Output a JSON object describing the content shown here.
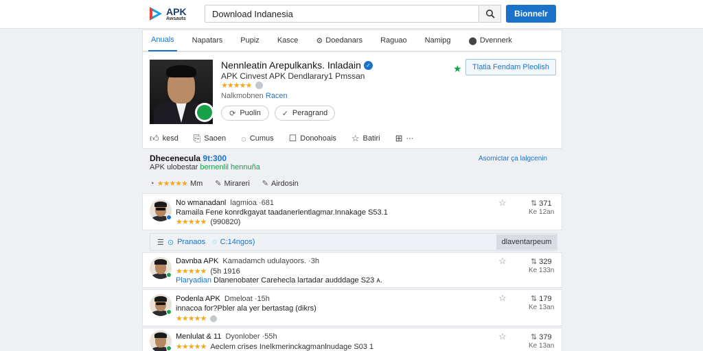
{
  "header": {
    "logo_line1": "APK",
    "logo_line2": "Awsauts",
    "search_value": "Download Indanesia",
    "primary_button": "Bionnelr"
  },
  "tabs": [
    {
      "label": "Anuals",
      "active": true,
      "icon": ""
    },
    {
      "label": "Napatars",
      "active": false,
      "icon": ""
    },
    {
      "label": "Pupiz",
      "active": false,
      "icon": ""
    },
    {
      "label": "Kasce",
      "active": false,
      "icon": ""
    },
    {
      "label": "Doedanars",
      "active": false,
      "icon": "gear-icon"
    },
    {
      "label": "Raguao",
      "active": false,
      "icon": ""
    },
    {
      "label": "Namipg",
      "active": false,
      "icon": ""
    },
    {
      "label": "Dvennerk",
      "active": false,
      "icon": "pin-icon"
    }
  ],
  "profile": {
    "title": "Nennleatin Arepulkanks. Inladain",
    "subtitle": "APK Cinvest APK Dendlarary1 Pmssan",
    "category_prefix": "Nalkmobnen",
    "category_link": "Racen",
    "pill_left": "Puolin",
    "pill_right": "Peragrand",
    "follow_button": "Tlatia Fendam Pleolish",
    "rating_fraction": 0.8
  },
  "actions": [
    {
      "label": "kesd",
      "icon": "thumbs-up-icon"
    },
    {
      "label": "Saoen",
      "icon": "save-icon"
    },
    {
      "label": "Cumus",
      "icon": "comment-icon"
    },
    {
      "label": "Donohoais",
      "icon": "download-icon"
    },
    {
      "label": "Batiri",
      "icon": "star-icon"
    },
    {
      "label": "···",
      "icon": "grid-icon"
    }
  ],
  "section": {
    "title_prefix": "Dhecenecula",
    "title_value": "9t:300",
    "sub_prefix": "APK ulobestar",
    "sub_highlight": "bernenlil hennuña",
    "link": "Asomictar ça lalgcenin",
    "rating_label": "Mm",
    "item2": "Mirareri",
    "item3": "Airdosin"
  },
  "toolbar": {
    "item1": "Pranaos",
    "item2": "C:14ngos)",
    "button": "dlaventarpeum"
  },
  "reviews": [
    {
      "name": "No wmanadanl",
      "meta": "lagmioa ·681",
      "text_tag": "",
      "text": "Ramaila Fene konrdkgayat taadanerlentlagmar.Innakage S53.1",
      "stars": "★★★★★",
      "count": "(990820)",
      "score": "371",
      "ago": "Ke 12an",
      "dot_color": "#1a73c9"
    },
    {
      "name": "Davnba APK",
      "meta": "Kamadamch udulayoors. ·3h",
      "text_tag": "Plaryadian",
      "text": "Dlanenobater Carehecla lartadar audddage S23 ᴀ.",
      "stars": "★★★★★",
      "count": "(5h 1916",
      "score": "329",
      "ago": "Ke 133n",
      "dot_color": "#19a04a"
    },
    {
      "name": "Podenla APK",
      "meta": "Dmeloat ·15h",
      "text_tag": "",
      "text": "innacoa for?Pbler ala yer bertastag (dikrs)",
      "stars": "★★★★★",
      "count": "",
      "score": "179",
      "ago": "Ke 13an",
      "dot_color": "#19a04a"
    },
    {
      "name": "Menlulat & 11",
      "meta": "Dyonlober ·55h",
      "text_tag": "",
      "text": "Aeclem crises Inelkmerinckagmanlnudage S03 1",
      "stars": "★★★★★",
      "count": "",
      "score": "379",
      "ago": "Ke 13an",
      "dot_color": "#19a04a"
    }
  ]
}
